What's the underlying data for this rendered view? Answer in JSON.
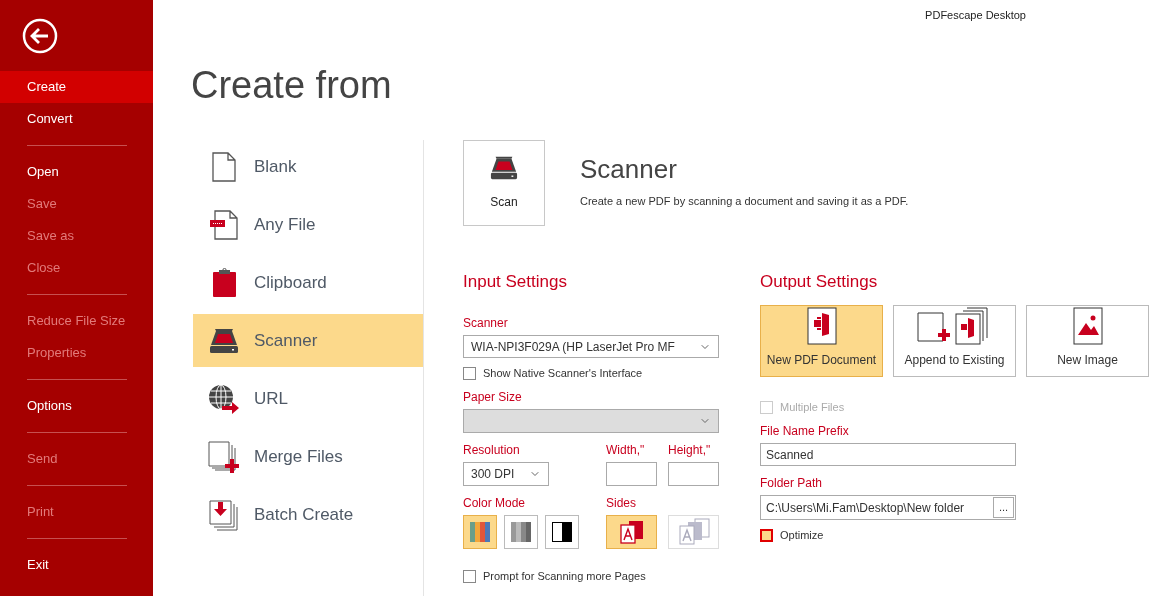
{
  "app_title": "PDFescape Desktop",
  "sidebar": {
    "items": [
      {
        "kind": "item",
        "label": "Create",
        "selected": true,
        "disabled": false
      },
      {
        "kind": "item",
        "label": "Convert",
        "selected": false,
        "disabled": false
      },
      {
        "kind": "divider"
      },
      {
        "kind": "item",
        "label": "Open",
        "selected": false,
        "disabled": false
      },
      {
        "kind": "item",
        "label": "Save",
        "selected": false,
        "disabled": true
      },
      {
        "kind": "item",
        "label": "Save as",
        "selected": false,
        "disabled": true
      },
      {
        "kind": "item",
        "label": "Close",
        "selected": false,
        "disabled": true
      },
      {
        "kind": "divider"
      },
      {
        "kind": "item",
        "label": "Reduce File Size",
        "selected": false,
        "disabled": true
      },
      {
        "kind": "item",
        "label": "Properties",
        "selected": false,
        "disabled": true
      },
      {
        "kind": "divider"
      },
      {
        "kind": "item",
        "label": "Options",
        "selected": false,
        "disabled": false
      },
      {
        "kind": "divider"
      },
      {
        "kind": "item",
        "label": "Send",
        "selected": false,
        "disabled": true
      },
      {
        "kind": "divider"
      },
      {
        "kind": "item",
        "label": "Print",
        "selected": false,
        "disabled": true
      },
      {
        "kind": "divider"
      },
      {
        "kind": "item",
        "label": "Exit",
        "selected": false,
        "disabled": false
      }
    ]
  },
  "page_title": "Create from",
  "sources": [
    {
      "label": "Blank",
      "selected": false
    },
    {
      "label": "Any File",
      "selected": false
    },
    {
      "label": "Clipboard",
      "selected": false
    },
    {
      "label": "Scanner",
      "selected": true
    },
    {
      "label": "URL",
      "selected": false
    },
    {
      "label": "Merge Files",
      "selected": false
    },
    {
      "label": "Batch Create",
      "selected": false
    }
  ],
  "scan_button": {
    "label": "Scan"
  },
  "heading": "Scanner",
  "description": "Create a new PDF by scanning a document and saving it as a PDF.",
  "input_settings": {
    "title": "Input Settings",
    "scanner": {
      "label": "Scanner",
      "value": "WIA-NPI3F029A (HP LaserJet Pro MF"
    },
    "native_interface": {
      "label": "Show Native Scanner's Interface",
      "checked": false
    },
    "paper_size": {
      "label": "Paper Size",
      "disabled": true
    },
    "resolution": {
      "label": "Resolution",
      "value": "300 DPI"
    },
    "width": {
      "label": "Width,\""
    },
    "height": {
      "label": "Height,\""
    },
    "color_mode": {
      "label": "Color Mode",
      "options": [
        {
          "selected": true
        },
        {
          "selected": false
        },
        {
          "selected": false
        }
      ]
    },
    "sides": {
      "label": "Sides",
      "options": [
        {
          "selected": true,
          "disabled": false
        },
        {
          "selected": false,
          "disabled": true
        }
      ]
    },
    "prompt_more_pages": {
      "label": "Prompt for Scanning more Pages",
      "checked": false
    }
  },
  "output_settings": {
    "title": "Output Settings",
    "targets": [
      {
        "label": "New PDF Document",
        "selected": true
      },
      {
        "label": "Append to Existing",
        "selected": false
      },
      {
        "label": "New Image",
        "selected": false
      }
    ],
    "multiple_files": {
      "label": "Multiple Files",
      "checked": false,
      "disabled": true
    },
    "file_name_prefix": {
      "label": "File Name Prefix",
      "value": "Scanned"
    },
    "folder_path": {
      "label": "Folder Path",
      "value": "C:\\Users\\Mi.Fam\\Desktop\\New folder",
      "browse": "..."
    },
    "optimize": {
      "label": "Optimize",
      "checked": false,
      "focused": true
    }
  }
}
